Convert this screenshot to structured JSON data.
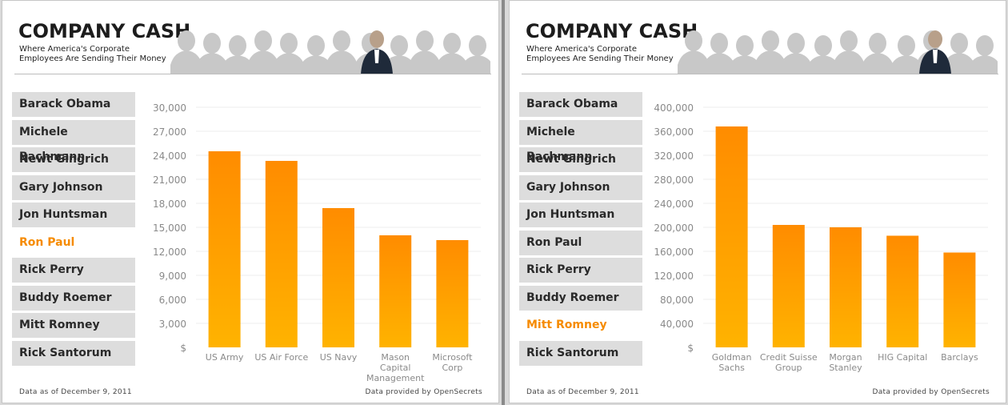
{
  "panels": [
    {
      "title": "COMPANY CASH",
      "subtitle_line1": "Where America's Corporate",
      "subtitle_line2": "Employees Are Sending Their Money",
      "candidates": [
        "Barack Obama",
        "Michele Bachmann",
        "Newt Gingrich",
        "Gary Johnson",
        "Jon Huntsman",
        "Ron Paul",
        "Rick Perry",
        "Buddy Roemer",
        "Mitt Romney",
        "Rick Santorum"
      ],
      "selected_candidate": "Ron Paul",
      "footer_left": "Data as of December 9, 2011",
      "footer_right": "Data provided by OpenSecrets"
    },
    {
      "title": "COMPANY CASH",
      "subtitle_line1": "Where America's Corporate",
      "subtitle_line2": "Employees Are Sending Their Money",
      "candidates": [
        "Barack Obama",
        "Michele Bachmann",
        "Newt Gingrich",
        "Gary Johnson",
        "Jon Huntsman",
        "Ron Paul",
        "Rick Perry",
        "Buddy Roemer",
        "Mitt Romney",
        "Rick Santorum"
      ],
      "selected_candidate": "Mitt Romney",
      "footer_left": "Data as of December 9, 2011",
      "footer_right": "Data provided by OpenSecrets"
    }
  ],
  "colors": {
    "bar_top": "#ff8c00",
    "bar_bottom": "#ffb300",
    "selected_text": "#f68b00",
    "candidate_bg": "#dddddd",
    "silhouette": "#c8c8c8"
  },
  "chart_data": [
    {
      "type": "bar",
      "categories": [
        [
          "US Army"
        ],
        [
          "US Air Force"
        ],
        [
          "US Navy"
        ],
        [
          "Mason",
          "Capital",
          "Management"
        ],
        [
          "Microsoft",
          "Corp"
        ]
      ],
      "values": [
        24500,
        23300,
        17400,
        14000,
        13400
      ],
      "yticks": [
        "$",
        "3,000",
        "6,000",
        "9,000",
        "12,000",
        "15,000",
        "18,000",
        "21,000",
        "24,000",
        "27,000",
        "30,000"
      ],
      "ylim": [
        0,
        30000
      ],
      "grid": true
    },
    {
      "type": "bar",
      "categories": [
        [
          "Goldman",
          "Sachs"
        ],
        [
          "Credit Suisse",
          "Group"
        ],
        [
          "Morgan",
          "Stanley"
        ],
        [
          "HIG Capital"
        ],
        [
          "Barclays"
        ]
      ],
      "values": [
        368000,
        204000,
        200000,
        186000,
        158000
      ],
      "yticks": [
        "$",
        "40,000",
        "80,000",
        "120,000",
        "160,000",
        "200,000",
        "240,000",
        "280,000",
        "320,000",
        "360,000",
        "400,000"
      ],
      "ylim": [
        0,
        400000
      ],
      "grid": true
    }
  ]
}
